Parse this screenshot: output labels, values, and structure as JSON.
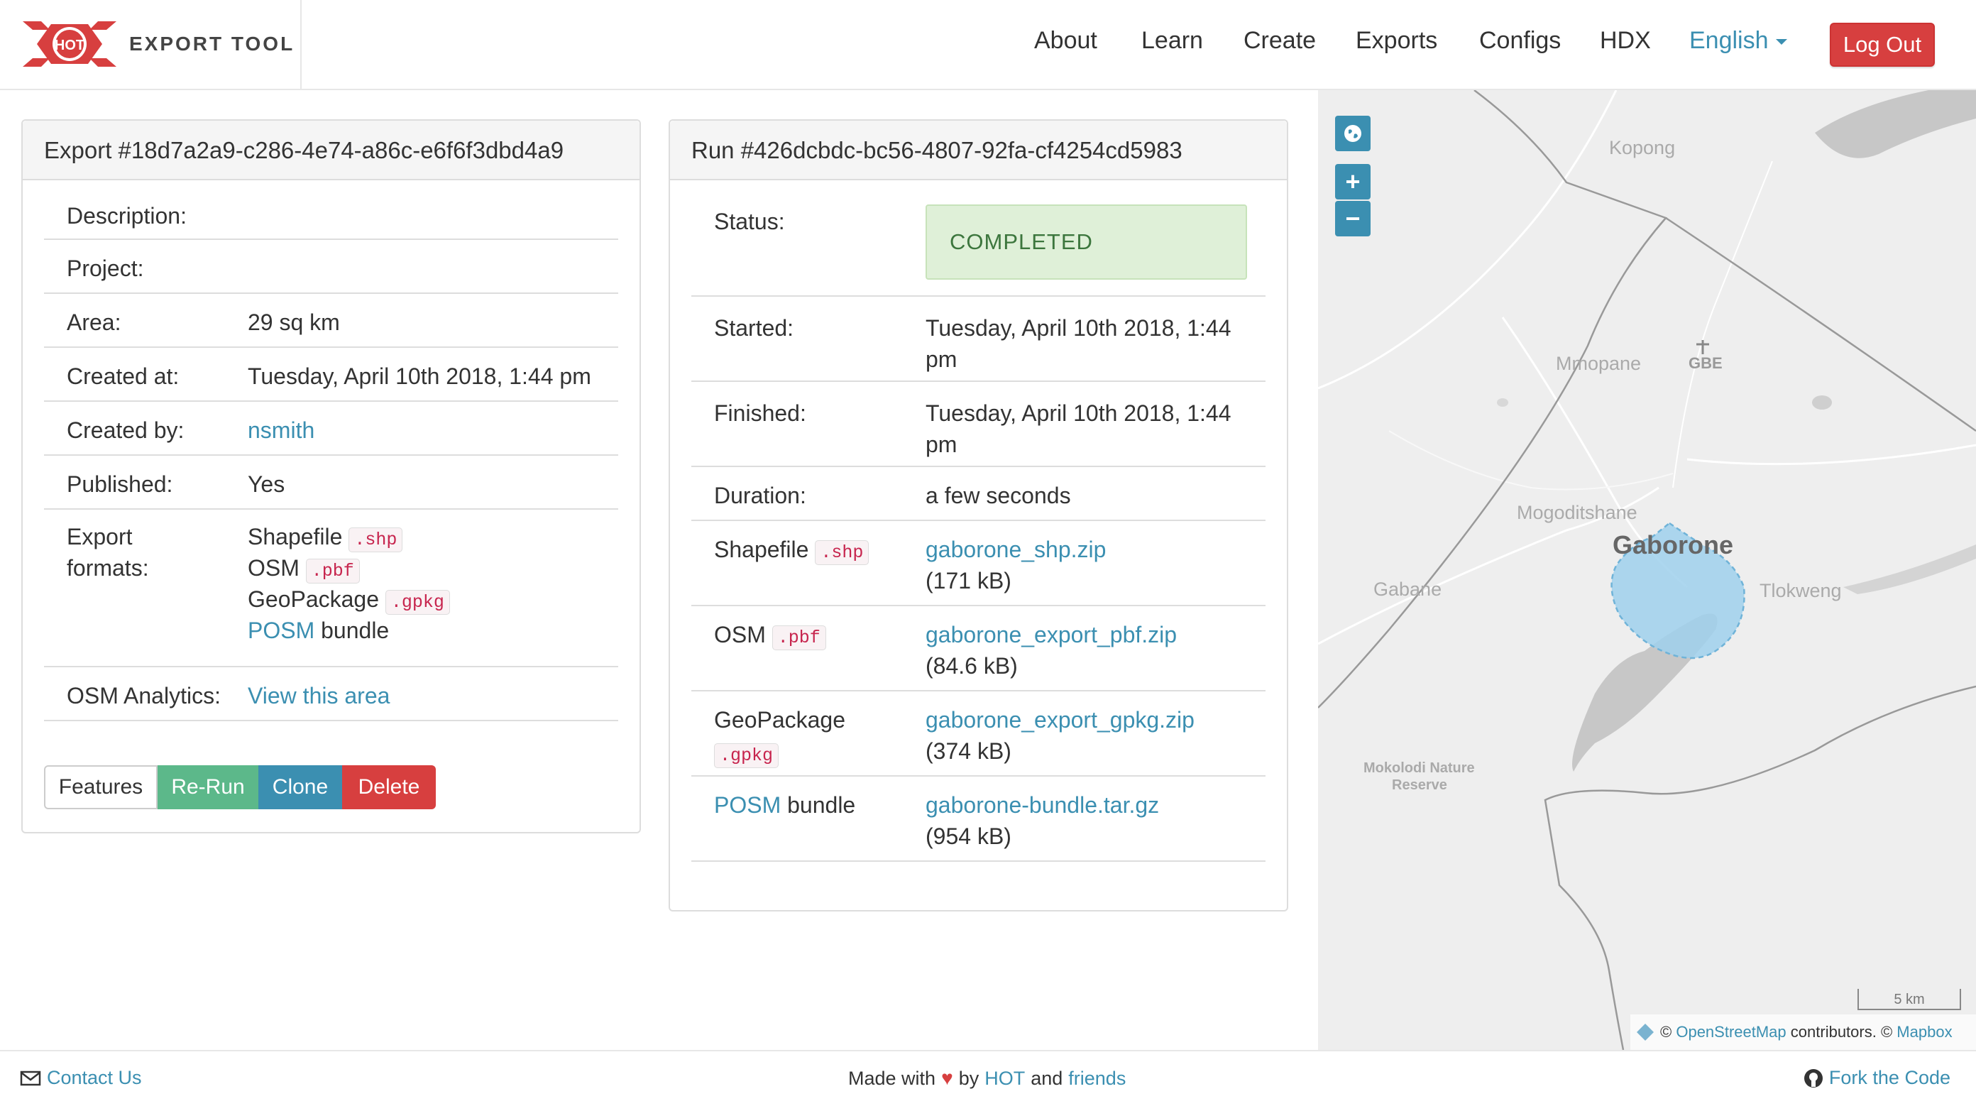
{
  "brand": {
    "logo_text": "HOT",
    "title": "EXPORT TOOL"
  },
  "nav": {
    "about": "About",
    "learn": "Learn",
    "create": "Create",
    "exports": "Exports",
    "configs": "Configs",
    "hdx": "HDX",
    "language": "English",
    "logout": "Log Out"
  },
  "export_panel": {
    "heading": "Export #18d7a2a9-c286-4e74-a86c-e6f6f3dbd4a9",
    "description_label": "Description:",
    "project_label": "Project:",
    "area_label": "Area:",
    "area_value": "29 sq km",
    "created_at_label": "Created at:",
    "created_at_value": "Tuesday, April 10th 2018, 1:44 pm",
    "created_by_label": "Created by:",
    "created_by_value": "nsmith",
    "published_label": "Published:",
    "published_value": "Yes",
    "formats_label_1": "Export",
    "formats_label_2": "formats:",
    "formats": [
      {
        "name": "Shapefile",
        "ext": ".shp"
      },
      {
        "name": "OSM",
        "ext": ".pbf"
      },
      {
        "name": "GeoPackage",
        "ext": ".gpkg"
      },
      {
        "name": "POSM",
        "suffix": "bundle"
      }
    ],
    "analytics_label": "OSM Analytics:",
    "analytics_link": "View this area",
    "buttons": {
      "features": "Features",
      "rerun": "Re-Run",
      "clone": "Clone",
      "delete": "Delete"
    }
  },
  "run_panel": {
    "heading": "Run #426dcbdc-bc56-4807-92fa-cf4254cd5983",
    "status_label": "Status:",
    "status_value": "COMPLETED",
    "started_label": "Started:",
    "started_line1": "Tuesday, April 10th 2018, 1:44",
    "started_line2": "pm",
    "finished_label": "Finished:",
    "finished_line1": "Tuesday, April 10th 2018, 1:44",
    "finished_line2": "pm",
    "duration_label": "Duration:",
    "duration_value": "a few seconds",
    "files": [
      {
        "format": "Shapefile",
        "ext": ".shp",
        "file": "gaborone_shp.zip",
        "size": "(171 kB)"
      },
      {
        "format": "OSM",
        "ext": ".pbf",
        "file": "gaborone_export_pbf.zip",
        "size": "(84.6 kB)"
      },
      {
        "format": "GeoPackage",
        "ext": ".gpkg",
        "file": "gaborone_export_gpkg.zip",
        "size": "(374 kB)"
      },
      {
        "format": "POSM",
        "suffix": "bundle",
        "file": "gaborone-bundle.tar.gz",
        "size": "(954 kB)"
      }
    ]
  },
  "map": {
    "places": {
      "kopong": "Kopong",
      "mmopane": "Mmopane",
      "gbe": "GBE",
      "mogoditshane": "Mogoditshane",
      "gaborone": "Gaborone",
      "gabane": "Gabane",
      "tlokweng": "Tlokweng",
      "mokolodi_1": "Mokolodi Nature",
      "mokolodi_2": "Reserve"
    },
    "scale": "5 km",
    "attribution": {
      "copyright": "©",
      "osm": "OpenStreetMap",
      "contributors": "contributors. ©",
      "mapbox": "Mapbox"
    },
    "zoom_in": "+",
    "zoom_out": "−"
  },
  "footer": {
    "contact": "Contact Us",
    "made_with": "Made with",
    "by": "by",
    "hot": "HOT",
    "and": "and",
    "friends": "friends",
    "fork": "Fork the Code"
  },
  "colors": {
    "accent": "#3b8fb1",
    "danger": "#d73f3f",
    "success": "#5cb88a",
    "status_bg": "#dff0d8",
    "map_bg": "#eeeeee",
    "aoi_fill": "#9fd0ec"
  }
}
